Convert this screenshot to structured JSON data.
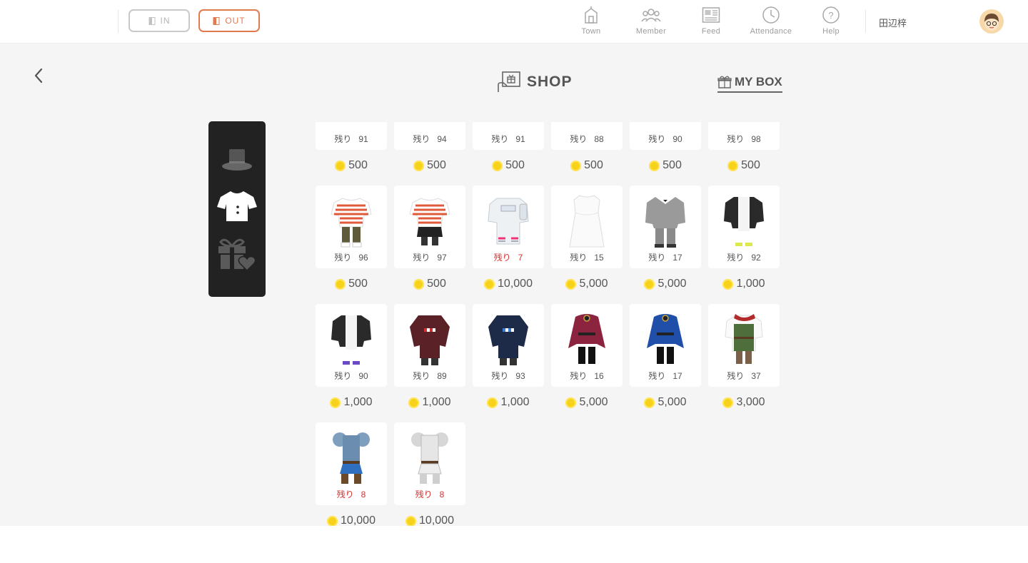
{
  "header": {
    "in_label": "IN",
    "out_label": "OUT",
    "nav": [
      {
        "label": "Town",
        "icon": "town-icon"
      },
      {
        "label": "Member",
        "icon": "member-icon"
      },
      {
        "label": "Feed",
        "icon": "feed-icon"
      },
      {
        "label": "Attendance",
        "icon": "attendance-icon"
      },
      {
        "label": "Help",
        "icon": "help-icon"
      }
    ],
    "user_name": "田辺梓"
  },
  "shop": {
    "title": "SHOP",
    "mybox_label": "MY BOX",
    "stock_label": "残り",
    "categories": [
      "hat-icon",
      "shirt-icon",
      "gift-icon"
    ]
  },
  "items": [
    {
      "stock": "91",
      "price": "500",
      "low": false,
      "outfit": "none"
    },
    {
      "stock": "94",
      "price": "500",
      "low": false,
      "outfit": "none"
    },
    {
      "stock": "91",
      "price": "500",
      "low": false,
      "outfit": "none"
    },
    {
      "stock": "88",
      "price": "500",
      "low": false,
      "outfit": "none"
    },
    {
      "stock": "90",
      "price": "500",
      "low": false,
      "outfit": "none"
    },
    {
      "stock": "98",
      "price": "500",
      "low": false,
      "outfit": "none"
    },
    {
      "stock": "96",
      "price": "500",
      "low": false,
      "outfit": "striped-olive"
    },
    {
      "stock": "97",
      "price": "500",
      "low": false,
      "outfit": "striped-black"
    },
    {
      "stock": "7",
      "price": "10,000",
      "low": true,
      "outfit": "astronaut"
    },
    {
      "stock": "15",
      "price": "5,000",
      "low": false,
      "outfit": "white-dress"
    },
    {
      "stock": "17",
      "price": "5,000",
      "low": false,
      "outfit": "grey-suit"
    },
    {
      "stock": "92",
      "price": "1,000",
      "low": false,
      "outfit": "black-jacket"
    },
    {
      "stock": "90",
      "price": "1,000",
      "low": false,
      "outfit": "black-jacket-white"
    },
    {
      "stock": "89",
      "price": "1,000",
      "low": false,
      "outfit": "red-kimono"
    },
    {
      "stock": "93",
      "price": "1,000",
      "low": false,
      "outfit": "navy-kimono"
    },
    {
      "stock": "16",
      "price": "5,000",
      "low": false,
      "outfit": "crimson-cape"
    },
    {
      "stock": "17",
      "price": "5,000",
      "low": false,
      "outfit": "blue-cape"
    },
    {
      "stock": "37",
      "price": "3,000",
      "low": false,
      "outfit": "green-tunic"
    },
    {
      "stock": "8",
      "price": "10,000",
      "low": true,
      "outfit": "blue-armor"
    },
    {
      "stock": "8",
      "price": "10,000",
      "low": true,
      "outfit": "silver-armor"
    }
  ],
  "colors": {
    "accent_out": "#e07a4f",
    "low_stock": "#d0312d",
    "coin": "#f6d21a"
  }
}
